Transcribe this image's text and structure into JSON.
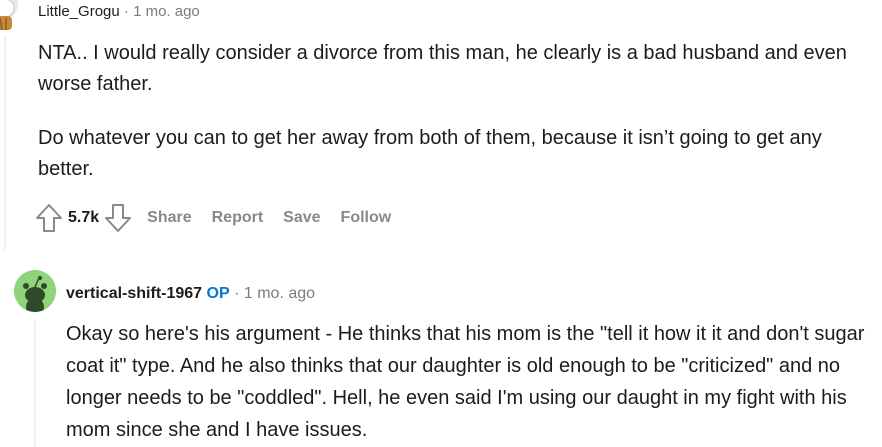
{
  "comments": [
    {
      "author": "Little_Grogu",
      "separator": "·",
      "time": "1 mo. ago",
      "paragraphs": [
        "NTA.. I would really consider a divorce from this man, he clearly is a bad husband and even worse father.",
        "Do whatever you can to get her away from both of them, because it isn’t going to get any better."
      ],
      "score": "5.7k",
      "actions": {
        "share": "Share",
        "report": "Report",
        "save": "Save",
        "follow": "Follow"
      },
      "icons": {
        "avatar": "snoo-avatar-icon",
        "upvote": "upvote-arrow-icon",
        "downvote": "downvote-arrow-icon"
      }
    },
    {
      "author": "vertical-shift-1967",
      "op_badge": "OP",
      "separator": "·",
      "time": "1 mo. ago",
      "paragraphs": [
        "Okay so here's his argument - He thinks that his mom is the \"tell it how it it and don't sugar coat it\" type. And he also thinks that our daughter is old enough to be \"criticized\" and no longer needs to be \"coddled\". Hell, he even said I'm using our daught in my fight with his mom since she and I have issues."
      ],
      "icons": {
        "avatar": "green-snoo-avatar-icon"
      }
    }
  ],
  "colors": {
    "op": "#0079d3",
    "muted": "#7c7c7c",
    "action": "#878a8c",
    "avatar_green": "#8fd47a"
  }
}
